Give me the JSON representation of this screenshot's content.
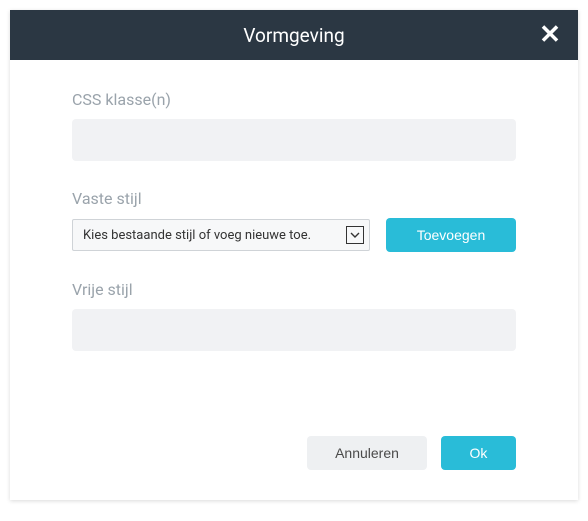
{
  "header": {
    "title": "Vormgeving"
  },
  "fields": {
    "css_class": {
      "label": "CSS klasse(n)",
      "value": ""
    },
    "fixed_style": {
      "label": "Vaste stijl",
      "placeholder": "Kies bestaande stijl of voeg nieuwe toe.",
      "add_label": "Toevoegen"
    },
    "free_style": {
      "label": "Vrije stijl",
      "value": ""
    }
  },
  "footer": {
    "cancel_label": "Annuleren",
    "ok_label": "Ok"
  },
  "icons": {
    "close": "✕"
  }
}
